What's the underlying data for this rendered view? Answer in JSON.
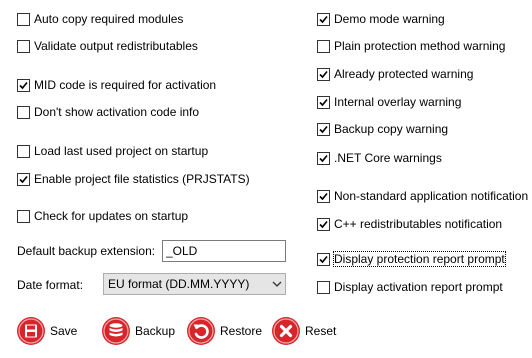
{
  "left_options": [
    {
      "label": "Auto copy required modules",
      "checked": false
    },
    {
      "label": "Validate output redistributables",
      "checked": false
    },
    {
      "label": "MID code is required for activation",
      "checked": true
    },
    {
      "label": "Don't show activation code info",
      "checked": false
    },
    {
      "label": "Load last used project on startup",
      "checked": false
    },
    {
      "label": "Enable project file statistics (PRJSTATS)",
      "checked": true
    },
    {
      "label": "Check for updates on startup",
      "checked": false
    }
  ],
  "right_options": [
    {
      "label": "Demo mode warning",
      "checked": true
    },
    {
      "label": "Plain protection method warning",
      "checked": false
    },
    {
      "label": "Already protected warning",
      "checked": true
    },
    {
      "label": "Internal overlay warning",
      "checked": true
    },
    {
      "label": "Backup copy warning",
      "checked": true
    },
    {
      "label": ".NET Core warnings",
      "checked": true
    },
    {
      "label": "Non-standard application notification",
      "checked": true
    },
    {
      "label": "C++ redistributables notification",
      "checked": true
    },
    {
      "label": "Display protection report prompt",
      "checked": true
    },
    {
      "label": "Display activation report prompt",
      "checked": false
    }
  ],
  "backup_extension": {
    "label": "Default backup extension:",
    "value": "_OLD"
  },
  "date_format": {
    "label": "Date format:",
    "value": "EU format (DD.MM.YYYY)"
  },
  "buttons": {
    "save": "Save",
    "backup": "Backup",
    "restore": "Restore",
    "reset": "Reset"
  },
  "colors": {
    "button_icon_red": "#d7262b",
    "checkmark": "#000000"
  }
}
